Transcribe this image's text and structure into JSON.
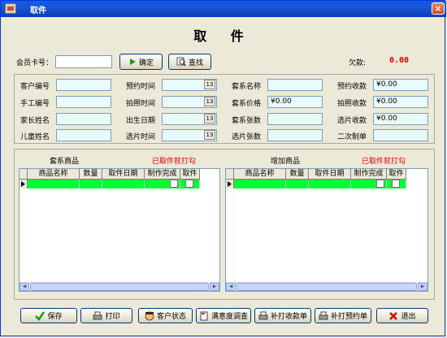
{
  "window": {
    "title": "取件",
    "close_glyph": "×"
  },
  "page_title": "取 件",
  "top": {
    "card_label": "会员卡号：",
    "card_value": "",
    "confirm_label": "确定",
    "search_label": "查找",
    "debt_label": "欠款:",
    "debt_value": "0.00"
  },
  "info": {
    "customer_no": {
      "label": "客户编号",
      "value": ""
    },
    "manual_no": {
      "label": "手工编号",
      "value": ""
    },
    "parent_name": {
      "label": "家长姓名",
      "value": ""
    },
    "child_name": {
      "label": "儿童姓名",
      "value": ""
    },
    "reserve_time": {
      "label": "预约时间",
      "value": ""
    },
    "shoot_time": {
      "label": "拍照时间",
      "value": ""
    },
    "birth_date": {
      "label": "出生日期",
      "value": ""
    },
    "select_time": {
      "label": "选片时间",
      "value": ""
    },
    "package_name": {
      "label": "套系名称",
      "value": ""
    },
    "package_price": {
      "label": "套系价格",
      "value": "¥0.00"
    },
    "package_count": {
      "label": "套系张数",
      "value": ""
    },
    "select_count": {
      "label": "选片张数",
      "value": ""
    },
    "reserve_fee": {
      "label": "预约收款",
      "value": "¥0.00"
    },
    "shoot_fee": {
      "label": "拍照收款",
      "value": "¥0.00"
    },
    "select_fee": {
      "label": "选片收款",
      "value": "¥0.00"
    },
    "second_order": {
      "label": "二次制单",
      "value": ""
    }
  },
  "left_panel": {
    "title": "套系商品",
    "hint": "已取件就打勾"
  },
  "right_panel": {
    "title": "增加商品",
    "hint": "已取件就打勾"
  },
  "grid_columns": [
    "商品名称",
    "数量",
    "取件日期",
    "制作完成",
    "取件"
  ],
  "colors": {
    "row_highlight": "#00ff33",
    "debt": "#e00000",
    "hint": "#e00000"
  },
  "icons": {
    "confirm": "play-arrow-icon",
    "search": "magnifier-icon",
    "save": "checkmark-icon",
    "print": "printer-icon",
    "customer_status": "user-face-icon",
    "survey": "document-icon",
    "reprint_receipt": "printer-icon",
    "reprint_reservation": "printer-icon",
    "exit": "red-x-icon"
  },
  "buttons": {
    "save": "保存",
    "print": "打印",
    "customer_status": "客户状态",
    "survey": "满意度调查",
    "reprint_receipt": "补打收款单",
    "reprint_reservation": "补打预约单",
    "exit": "退出"
  }
}
